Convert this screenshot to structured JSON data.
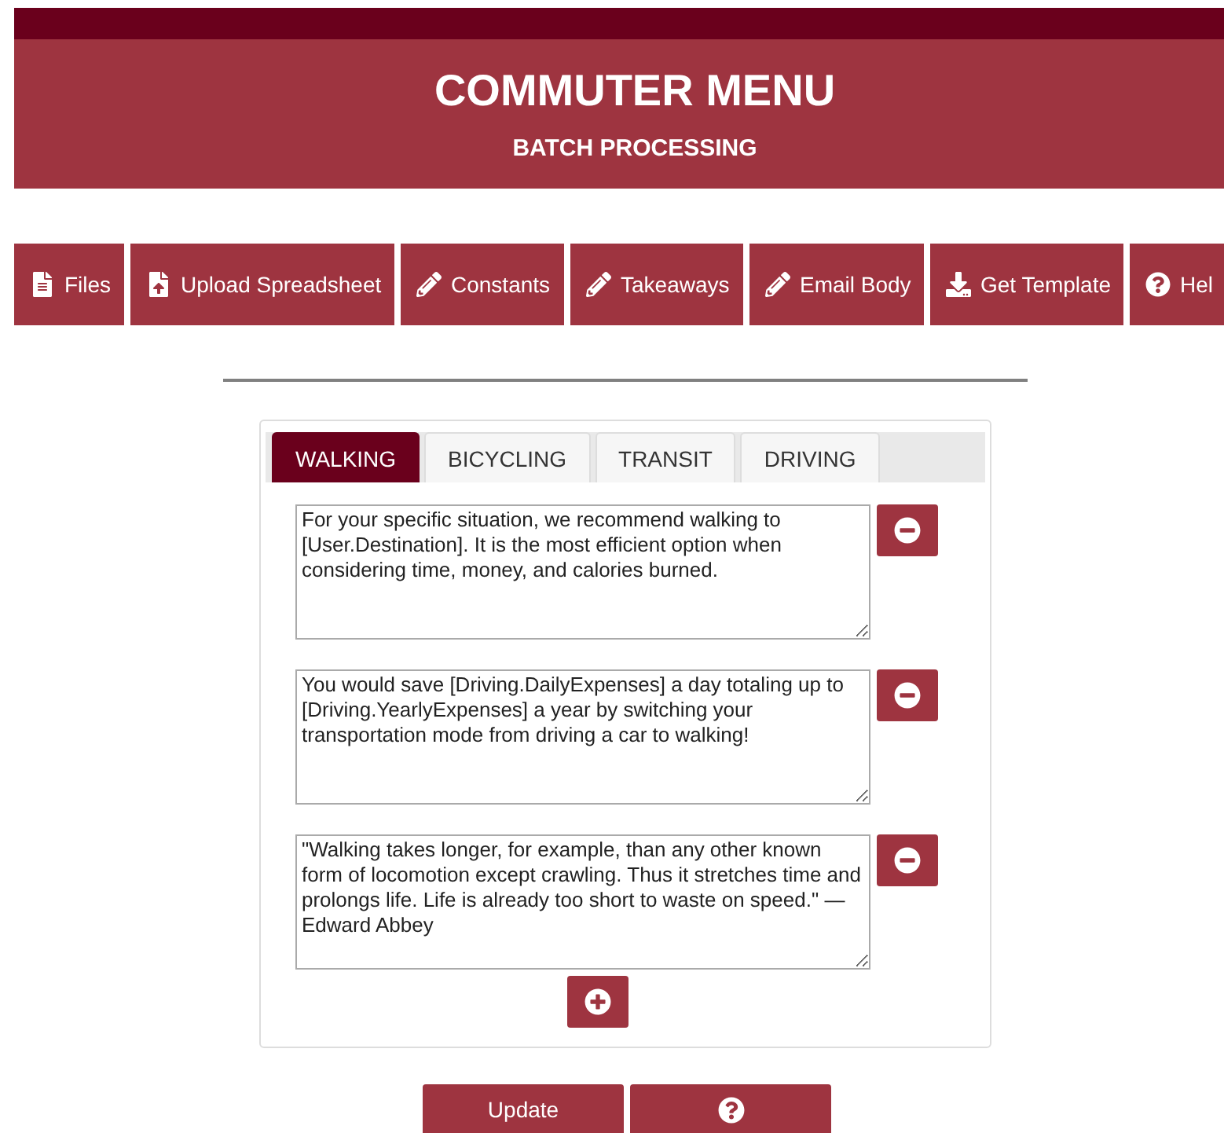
{
  "header": {
    "title": "COMMUTER MENU",
    "subtitle": "BATCH PROCESSING"
  },
  "nav": [
    {
      "label": "Files"
    },
    {
      "label": "Upload Spreadsheet"
    },
    {
      "label": "Constants"
    },
    {
      "label": "Takeaways"
    },
    {
      "label": "Email Body"
    },
    {
      "label": "Get Template"
    },
    {
      "label": "Hel"
    }
  ],
  "tabs": [
    {
      "label": "WALKING",
      "selected": true
    },
    {
      "label": "BICYCLING",
      "selected": false
    },
    {
      "label": "TRANSIT",
      "selected": false
    },
    {
      "label": "DRIVING",
      "selected": false
    }
  ],
  "messages": [
    "For your specific situation, we recommend walking to [User.Destination]. It is the most efficient option when considering time, money, and calories burned.",
    "You would save [Driving.DailyExpenses] a day totaling up to [Driving.YearlyExpenses] a year by switching your transportation mode from driving a car to walking!",
    "\"Walking takes longer, for example, than any other known form of locomotion except crawling. Thus it stretches time and prolongs life. Life is already too short to waste on speed.\" — Edward Abbey"
  ],
  "actions": {
    "update": "Update"
  }
}
